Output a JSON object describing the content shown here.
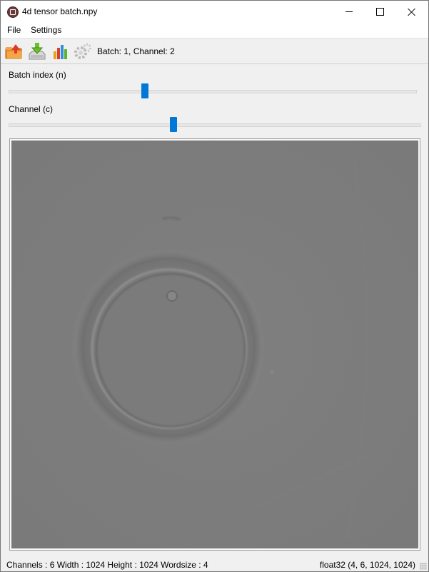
{
  "window": {
    "title": "4d tensor batch.npy",
    "app_icon": "tensor-viewer-app-icon",
    "controls": [
      "minimize-icon",
      "maximize-icon",
      "close-icon"
    ]
  },
  "menu": {
    "file": "File",
    "settings": "Settings"
  },
  "toolbar": {
    "buttons": [
      "open-folder-icon",
      "save-download-icon",
      "histogram-chart-icon",
      "gear-icon"
    ],
    "status": "Batch: 1, Channel: 2"
  },
  "sliders": {
    "batch": {
      "label": "Batch index (n)",
      "value": 1,
      "min": 0,
      "max": 3
    },
    "channel": {
      "label": "Channel (c)",
      "value": 2,
      "min": 0,
      "max": 5
    }
  },
  "image": {
    "description_icon": "grayscale-tensor-slice",
    "background_color": "#7d7d7d"
  },
  "statusbar": {
    "left": "Channels : 6 Width : 1024 Height : 1024 Wordsize : 4",
    "right": "float32 (4, 6, 1024, 1024)"
  },
  "colors": {
    "accent": "#0078d7",
    "chrome": "#f0f0f0",
    "titlebar": "#ffffff"
  }
}
